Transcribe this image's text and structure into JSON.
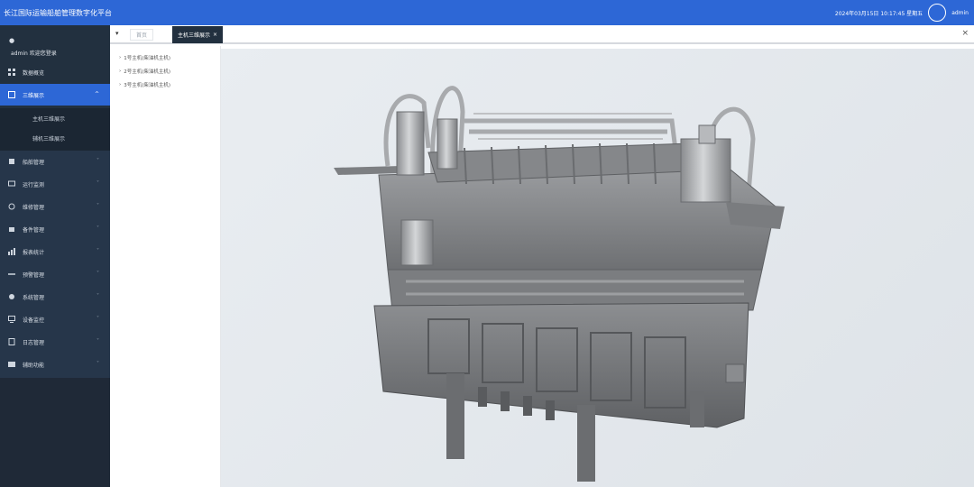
{
  "header": {
    "title": "长江国际运输船舶管理数字化平台",
    "datetime": "2024年03月15日 10:17:45 星期五",
    "username": "admin"
  },
  "sidebar": {
    "user_label": "admin 欢迎您登录",
    "items": [
      {
        "label": "数据概览",
        "icon": "dashboard-icon"
      },
      {
        "label": "三维展示",
        "icon": "cube-icon",
        "active": true
      },
      {
        "label": "船舶管理",
        "icon": "ship-icon"
      },
      {
        "label": "运行监测",
        "icon": "monitor-icon"
      },
      {
        "label": "维修管理",
        "icon": "wrench-icon"
      },
      {
        "label": "备件管理",
        "icon": "box-icon"
      },
      {
        "label": "报表统计",
        "icon": "chart-icon"
      },
      {
        "label": "预警管理",
        "icon": "alert-icon"
      },
      {
        "label": "系统管理",
        "icon": "gear-icon"
      },
      {
        "label": "设备监控",
        "icon": "screen-icon"
      },
      {
        "label": "日志管理",
        "icon": "log-icon"
      },
      {
        "label": "辅助功能",
        "icon": "tool-icon"
      }
    ],
    "submenu": [
      "主机三维展示",
      "辅机三维展示"
    ]
  },
  "tabs": {
    "home": "首页",
    "active": "主机三维展示",
    "close_icon": "close-icon"
  },
  "tree": {
    "nodes": [
      "1号主机(柴油机主机)",
      "2号主机(柴油机主机)",
      "3号主机(柴油机主机)"
    ]
  },
  "colors": {
    "header": "#2d67d6",
    "sidebar": "#22303f",
    "active": "#2d67d6",
    "viewer_bg": "#e6eaee"
  }
}
